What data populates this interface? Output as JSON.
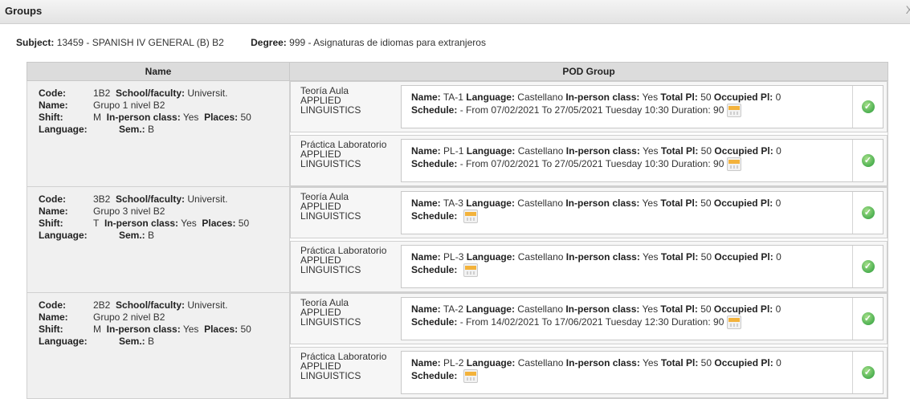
{
  "window": {
    "title": "Groups",
    "close_glyph": "X"
  },
  "subject": {
    "subject_label": "Subject:",
    "subject_value": "13459 - SPANISH IV GENERAL (B) B2",
    "degree_label": "Degree:",
    "degree_value": "999 - Asignaturas de idiomas para extranjeros"
  },
  "table": {
    "col_name": "Name",
    "col_pod": "POD Group"
  },
  "labels": {
    "code": "Code:",
    "name": "Name:",
    "shift": "Shift:",
    "language": "Language:",
    "school": "School/faculty:",
    "inperson": "In-person class:",
    "places": "Places:",
    "sem": "Sem.:",
    "pod_name": "Name:",
    "pod_language": "Language:",
    "pod_inperson": "In-person class:",
    "total_pl": "Total Pl:",
    "occupied_pl": "Occupied Pl:",
    "schedule": "Schedule:"
  },
  "groups": [
    {
      "code": "1B2",
      "school": "Universit.",
      "name": "Grupo 1 nivel B2",
      "shift": "M",
      "inperson": "Yes",
      "places": "50",
      "language": "",
      "sem": "B",
      "pods": [
        {
          "type": "Teoría Aula",
          "dept": "APPLIED LINGUISTICS",
          "name": "TA-1",
          "language": "Castellano",
          "inperson": "Yes",
          "total": "50",
          "occupied": "0",
          "schedule": "- From 07/02/2021 To 27/05/2021 Tuesday 10:30 Duration: 90"
        },
        {
          "type": "Práctica Laboratorio",
          "dept": "APPLIED LINGUISTICS",
          "name": "PL-1",
          "language": "Castellano",
          "inperson": "Yes",
          "total": "50",
          "occupied": "0",
          "schedule": "- From 07/02/2021 To 27/05/2021 Tuesday 10:30 Duration: 90"
        }
      ]
    },
    {
      "code": "3B2",
      "school": "Universit.",
      "name": "Grupo 3 nivel B2",
      "shift": "T",
      "inperson": "Yes",
      "places": "50",
      "language": "",
      "sem": "B",
      "pods": [
        {
          "type": "Teoría Aula",
          "dept": "APPLIED LINGUISTICS",
          "name": "TA-3",
          "language": "Castellano",
          "inperson": "Yes",
          "total": "50",
          "occupied": "0",
          "schedule": ""
        },
        {
          "type": "Práctica Laboratorio",
          "dept": "APPLIED LINGUISTICS",
          "name": "PL-3",
          "language": "Castellano",
          "inperson": "Yes",
          "total": "50",
          "occupied": "0",
          "schedule": ""
        }
      ]
    },
    {
      "code": "2B2",
      "school": "Universit.",
      "name": "Grupo 2 nivel B2",
      "shift": "M",
      "inperson": "Yes",
      "places": "50",
      "language": "",
      "sem": "B",
      "pods": [
        {
          "type": "Teoría Aula",
          "dept": "APPLIED LINGUISTICS",
          "name": "TA-2",
          "language": "Castellano",
          "inperson": "Yes",
          "total": "50",
          "occupied": "0",
          "schedule": "- From 14/02/2021 To 17/06/2021 Tuesday 12:30 Duration: 90"
        },
        {
          "type": "Práctica Laboratorio",
          "dept": "APPLIED LINGUISTICS",
          "name": "PL-2",
          "language": "Castellano",
          "inperson": "Yes",
          "total": "50",
          "occupied": "0",
          "schedule": ""
        }
      ]
    }
  ],
  "icons": {
    "check": "check-circle-icon",
    "calendar": "calendar-icon"
  },
  "colors": {
    "check": "#4caf50",
    "calendar": "#f3b23b",
    "header_bg": "#dcdcdc"
  }
}
